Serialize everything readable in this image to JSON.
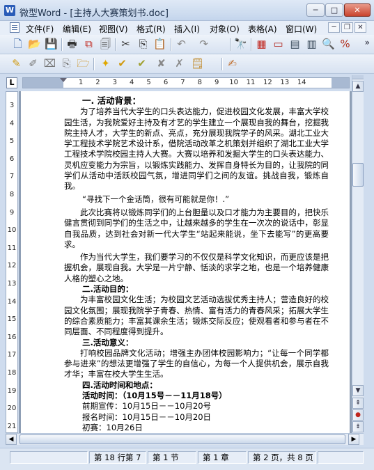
{
  "window": {
    "logo": "W",
    "title": "微型Word - [主持人大赛策划书.doc]",
    "min": "─",
    "max": "□",
    "close": "✕"
  },
  "menu": {
    "items": [
      "文件(F)",
      "编辑(E)",
      "视图(V)",
      "格式(R)",
      "插入(I)",
      "对象(O)",
      "表格(A)",
      "窗口(W)"
    ],
    "mdi_min": "─",
    "mdi_restore": "❐",
    "mdi_close": "✕"
  },
  "toolbar1": {
    "icons": [
      {
        "name": "new-document-icon",
        "glyph": "🗋",
        "color": "#2b5aa0"
      },
      {
        "name": "open-folder-icon",
        "glyph": "📂",
        "color": "#c98a12"
      },
      {
        "name": "save-icon",
        "glyph": "💾",
        "color": "#1f4fa0"
      },
      {
        "name": "print-icon",
        "glyph": "🖶",
        "color": "#333"
      },
      {
        "name": "pdf-export-icon",
        "glyph": "⧉",
        "color": "#c0261e"
      },
      {
        "name": "print-preview-icon",
        "glyph": "🗐",
        "color": "#444"
      },
      {
        "name": "cut-icon",
        "glyph": "✂",
        "color": "#333"
      },
      {
        "name": "copy-icon",
        "glyph": "⎘",
        "color": "#333"
      },
      {
        "name": "paste-icon",
        "glyph": "📋",
        "color": "#8a6a2a"
      },
      {
        "name": "undo-icon",
        "glyph": "↶",
        "color": "#888"
      },
      {
        "name": "redo-icon",
        "glyph": "↷",
        "color": "#888"
      },
      {
        "name": "find-icon",
        "glyph": "🔭",
        "color": "#333"
      },
      {
        "name": "table-insert-icon",
        "glyph": "▦",
        "color": "#c0261e"
      },
      {
        "name": "frame-icon",
        "glyph": "▭",
        "color": "#b0261e"
      },
      {
        "name": "page-layout-icon",
        "glyph": "▤",
        "color": "#345"
      },
      {
        "name": "columns-icon",
        "glyph": "▥",
        "color": "#345"
      },
      {
        "name": "zoom-icon",
        "glyph": "🔍",
        "color": "#2b5aa0"
      },
      {
        "name": "percent-icon",
        "glyph": "%",
        "color": "#b03020"
      }
    ],
    "more": "»"
  },
  "toolbar2": {
    "icons": [
      {
        "name": "highlight-pen-icon",
        "glyph": "✎",
        "color": "#d09a10"
      },
      {
        "name": "edit-pen-icon",
        "glyph": "✐",
        "color": "#777"
      },
      {
        "name": "delete-mark-icon",
        "glyph": "⌧",
        "color": "#777"
      },
      {
        "name": "copy-mark-icon",
        "glyph": "⎘",
        "color": "#777"
      },
      {
        "name": "track-folder-icon",
        "glyph": "🗁",
        "color": "#c98a12"
      },
      {
        "name": "accept-star-icon",
        "glyph": "✦",
        "color": "#e0a800"
      },
      {
        "name": "accept-check-icon",
        "glyph": "✔",
        "color": "#d09a10"
      },
      {
        "name": "accept-all-icon",
        "glyph": "✔",
        "color": "#a0a030"
      },
      {
        "name": "reject-icon",
        "glyph": "✘",
        "color": "#888"
      },
      {
        "name": "reject-all-icon",
        "glyph": "✗",
        "color": "#888"
      },
      {
        "name": "comment-note-icon",
        "glyph": "🗒",
        "color": "#c08a2a"
      },
      {
        "name": "review-pane-icon",
        "glyph": "✍",
        "color": "#c07030"
      }
    ]
  },
  "ruler": {
    "corner": "L",
    "numbers": [
      "1",
      "2",
      "3",
      "4",
      "5",
      "6",
      "7",
      "8",
      "9",
      "10",
      "11",
      "12",
      "13",
      "14"
    ]
  },
  "vruler": {
    "numbers": [
      "3",
      "4",
      "5",
      "6",
      "7",
      "8",
      "9",
      "10",
      "11",
      "12",
      "13",
      "14",
      "15",
      "16",
      "17",
      "18",
      "19",
      "20",
      "21"
    ]
  },
  "document": {
    "heading1": "一. 活动背景：",
    "p1": "为了培养当代大学生的口头表达能力，促进校园文化发展，丰富大学校园生活，为我院爱好主持及有才艺的学生建立一个展现自我的舞台，挖掘我院主持人才，大学生的新点、亮点，充分展现我院学子的风采。湖北工业大学工程技术学院艺术设计系，借院活动改革之机策划并组织了湖北工业大学工程技术学院校园主持人大赛。大赛以培养和发掘大学生的口头表达能力、灵机应变能力为宗旨，以锻炼实践能力、发挥自身特长为目的，让我院的同学们从活动中活跃校园气氛，增进同学们之间的友谊。挑战自我，锻炼自我。",
    "quote": "“寻找下一个金话筒，很有可能就是你！.”",
    "p2": "此次比赛将以锻炼同学们的上台胆量以及口才能力为主要目的，把快乐健言贯彻到同学们的生活之中，让越来越多的学生在一次次的说话中，彰显自我品质，达到社会对新一代大学生“站起来能说，坐下去能写”的更高要求。",
    "p3": "作为当代大学生，我们要学习的不仅仅是科学文化知识，而更应该是把握机会，展现自我。大学是一片宁静、恬淡的求学之地，也是一个培养健康人格的塑心之地。",
    "heading2": "二.活动目的：",
    "p4": "为丰富校园文化生活；为校园文艺活动选拔优秀主持人；营造良好的校园文化氛围；展现我院学子青春、热情、富有活力的青春风采；拓展大学生的综合素质能力；丰富其课余生活；锻炼交际反应；使观看者和参与者在不同层面、不同程度得到提升。",
    "heading3": "三.活动意义：",
    "p5": "打响校园品牌文化活动；增强主办团体校园影响力；“让每一个同学都参与进来”的想法更增强了学生的自信心，为每一个人提供机会，展示自我才华；丰富在校大学生生活。",
    "heading4": "四.活动时间和地点：",
    "time_label": "活动时间：（10月15号－－11月18号）",
    "l1": "前期宣传：10月15日－－10月20号",
    "l2": "报名时间：10月15日－－10月20日",
    "l3": "初赛：10月26日"
  },
  "scroll": {
    "up": "▲",
    "down": "▼",
    "prev_page": "⇞",
    "select_browse": "●",
    "next_page": "⇟",
    "left": "◀",
    "right": "▶"
  },
  "status": {
    "line_col": "第 18 行第 7",
    "section": "第 1 节",
    "chapter": "第 1 章",
    "page": "第 2 页，共 8 页"
  }
}
